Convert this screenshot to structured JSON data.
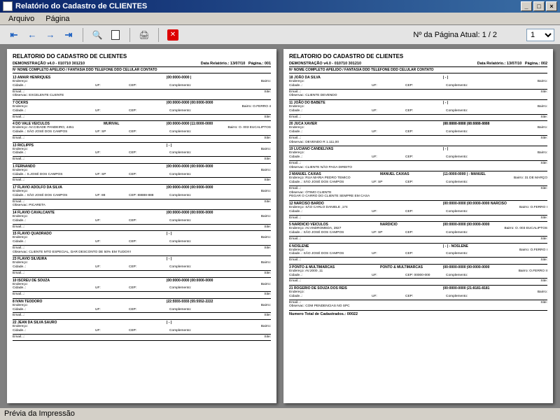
{
  "window": {
    "title": "Relatório do Cadastro de CLIENTES"
  },
  "menu": {
    "arquivo": "Arquivo",
    "pagina": "Página"
  },
  "toolbar": {
    "page_label": "Nº da Página Atual: 1 / 2",
    "page_selected": "1"
  },
  "statusbar": {
    "text": "Prévia da Impressão"
  },
  "report": {
    "title": "RELATORIO DO CADASTRO DE CLIENTES",
    "company": "DEMONSTRAÇÃO v4.0 - 010710 301210",
    "date_label": "Data Relatório.:",
    "date": "13/07/10",
    "page_word": "Página.:",
    "columns": "Nº   NOME COMPLETO                       APELIDO / FANTASIA      DDD TELEFONE DDD CELULAR   CONTATO",
    "labels": {
      "endereco": "Endereço:",
      "bairro": "Bairro:",
      "cidade": "Cidade..:",
      "uf": "UF:",
      "cep": "CEP:",
      "complemento": "Complemento:",
      "email": "Email...:",
      "site": "Site:",
      "observac": "Observac:"
    }
  },
  "pages": [
    {
      "num": "001",
      "clients": [
        {
          "id": "13 AMAIR HENRIQUES",
          "fant": "",
          "tel": "|00:0000-0000 |",
          "end": "",
          "bai": "",
          "cid": "",
          "uf": "",
          "cep": "",
          "comp": "",
          "email": "",
          "site": "",
          "obs": "EXCELENTE CLIENTE"
        },
        {
          "id": "7 OCKRS",
          "fant": "",
          "tel": "|00:0000-0000 |00:0000-0000",
          "end": "",
          "bai": "O.FERRO 4",
          "cid": "",
          "uf": "",
          "cep": "",
          "comp": "",
          "email": "",
          "site": "",
          "obs": ""
        },
        {
          "id": "4 DO VALE VEICULOS",
          "fant": "MURIVAL",
          "tel": "|00:0000-0000 |11:0000-0000",
          "end": "AV.CIDADE PANDEIRO, 4451",
          "bai": "O. 003 EUCALIPTOS",
          "cid": "SÃO JOSÉ DOS CAMPOS",
          "uf": "SP",
          "cep": "",
          "comp": "",
          "email": "",
          "site": "",
          "obs": ""
        },
        {
          "id": "13 RICLIPPS",
          "fant": "",
          "tel": "| - |",
          "end": "",
          "bai": "",
          "cid": "",
          "uf": "",
          "cep": "",
          "comp": "",
          "email": "",
          "site": "",
          "obs": ""
        },
        {
          "id": "1 FERNANDO",
          "fant": "",
          "tel": "|00:0000-0000 |00:0000-0000",
          "end": "",
          "bai": "",
          "cid": "S.JOSÉ DOS CAMPOS",
          "uf": "SP",
          "cep": "",
          "comp": "",
          "email": "",
          "site": "",
          "obs": ""
        },
        {
          "id": "17 FLAVIO ADOLFO DA SILVA",
          "fant": "",
          "tel": "|00:0000-0000 |00:0000-0000",
          "end": "",
          "bai": "",
          "cid": "SÃO JOSÉ DOS CAMPOS",
          "uf": "88",
          "cep": "88888-888",
          "comp": "",
          "email": "",
          "site": "",
          "obs": "PICARETA"
        },
        {
          "id": "14 FLAVIO CAVALCANTE",
          "fant": "",
          "tel": "|00:0000-0000 |00:0000-0000",
          "end": "",
          "bai": "",
          "cid": "",
          "uf": "",
          "cep": "",
          "comp": "",
          "email": "",
          "site": "",
          "obs": ""
        },
        {
          "id": "15 FLAVIO QUADRADO",
          "fant": "",
          "tel": "| - |",
          "end": "",
          "bai": "",
          "cid": "",
          "uf": "",
          "cep": "",
          "comp": "",
          "email": "",
          "site": "",
          "obs": "CLIENTE MTO ESPECIAL, DAR DESCONTO DE 50% EM TUDO!!!!"
        },
        {
          "id": "23 FLAVIO SILVEIRA",
          "fant": "",
          "tel": "| - |",
          "end": "",
          "bai": "",
          "cid": "",
          "uf": "",
          "cep": "",
          "comp": "",
          "email": "",
          "site": "",
          "obs": ""
        },
        {
          "id": "10 ISCREU DE SOUZA",
          "fant": "",
          "tel": "|00:0000-0000 |00:0000-0000",
          "end": "",
          "bai": "",
          "cid": "",
          "uf": "",
          "cep": "",
          "comp": "",
          "email": "",
          "site": "",
          "obs": ""
        },
        {
          "id": "8 IVAN TEODORO",
          "fant": "",
          "tel": "|22:5555-5555 |55:5552-2222",
          "end": "",
          "bai": "",
          "cid": "",
          "uf": "",
          "cep": "",
          "comp": "",
          "email": "",
          "site": "",
          "obs": ""
        },
        {
          "id": "22 JEAN DA SILVA SAURO",
          "fant": "",
          "tel": "| - |",
          "end": "",
          "bai": "",
          "cid": "",
          "uf": "",
          "cep": "",
          "comp": "",
          "email": "",
          "site": "",
          "obs": ""
        }
      ]
    },
    {
      "num": "002",
      "clients": [
        {
          "id": "18 JOÃO DA SILVA",
          "fant": "",
          "tel": "| - |",
          "end": "",
          "bai": "",
          "cid": "",
          "uf": "",
          "cep": "",
          "comp": "",
          "email": "",
          "site": "",
          "obs": "CLIENTE DEVENDO"
        },
        {
          "id": "11 JOÃO DO BABETE",
          "fant": "",
          "tel": "| - |",
          "end": "",
          "bai": "",
          "cid": "",
          "uf": "",
          "cep": "",
          "comp": "",
          "email": "",
          "site": "",
          "obs": ""
        },
        {
          "id": "20 JUCA XAVIER",
          "fant": "",
          "tel": "|88:8888-8888 |88:8888-8888",
          "end": "",
          "bai": "",
          "cid": "",
          "uf": "",
          "cep": "",
          "comp": "",
          "email": "",
          "site": "",
          "obs": "DEVENDO R 1.111,00"
        },
        {
          "id": "19 LUCIANO CANDELIVAS",
          "fant": "",
          "tel": "| - |",
          "end": "",
          "bai": "",
          "cid": "",
          "uf": "",
          "cep": "",
          "comp": "",
          "email": "",
          "site": "",
          "obs": "CLIENTE NÃO PAGA DIREITO"
        },
        {
          "id": "2 MANUEL CAXIAS",
          "fant": "MANUEL CAXIAS",
          "tel": "|11:0000-0000 | -         MANUEL",
          "end": "RUA MARIA PEDRO TEMICO",
          "bai": "31 DE MARÇO",
          "cid": "SÃO JOSÉ DOS CAMPOS",
          "uf": "SP",
          "cep": "",
          "comp": "",
          "email": "",
          "site": "",
          "obs": "ÓTIMO CLIENTE\nPEGAR O CARRO DO CLIENTE SEMPRE EM CASA"
        },
        {
          "id": "12 NARCISO BARDO",
          "fant": "",
          "tel": "|00:0000-0000 |00:0000-0000 NARCISO",
          "end": "SÃO CARLO DANIELE ,174",
          "bai": "O.FERRO I",
          "cid": "",
          "uf": "",
          "cep": "",
          "comp": "",
          "email": "",
          "site": "",
          "obs": ""
        },
        {
          "id": "5 NARDICIO VEICULOS",
          "fant": "NARDICIO",
          "tel": "|00:0000-0000 |00:0000-0000",
          "end": "AV.ANDROMEDA, 2827",
          "bai": "O. 003 EUCALIPTOS",
          "cid": "SÃO JOSÉ DOS CAMPOS",
          "uf": "SP",
          "cep": "",
          "comp": "",
          "email": "",
          "site": "",
          "obs": ""
        },
        {
          "id": "6 NOSLENE",
          "fant": "",
          "tel": "| - | -         NOSLENE",
          "end": "",
          "bai": "O.FERRO I",
          "cid": "SÃO JOSÉ DOS CAMPOS",
          "uf": "",
          "cep": "",
          "comp": "",
          "email": "",
          "site": "",
          "obs": ""
        },
        {
          "id": "3 PONTO & MULTIMARCAS",
          "fant": "PONTO & MULTIMARCAS",
          "tel": "|00:0000-0000 |00:0000-0000",
          "end": "AV.2000 ,11",
          "bai": "O.FERRO II",
          "cid": "",
          "uf": "",
          "cep": "00000-000",
          "comp": "",
          "email": "",
          "site": "",
          "obs": ""
        },
        {
          "id": "21 ROGERIO DE SOUZA DOS REIS",
          "fant": "",
          "tel": "|00:0000-0000 |21:8181-8181",
          "end": "",
          "bai": "",
          "cid": "",
          "uf": "",
          "cep": "",
          "comp": "",
          "email": "",
          "site": "",
          "obs": "COM PENDENCIAS NO SPC"
        }
      ],
      "total": "Numero Total de Cadastrados.: 00022"
    }
  ]
}
